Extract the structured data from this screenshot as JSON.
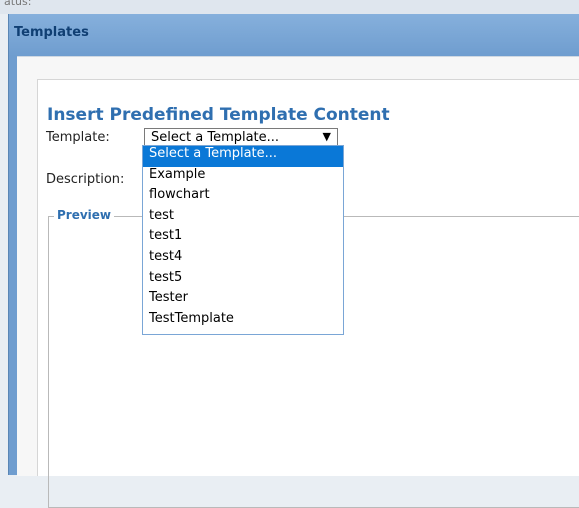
{
  "background": {
    "top_text": "atus:"
  },
  "dialog": {
    "title": "Templates",
    "heading": "Insert Predefined Template Content",
    "template_label": "Template:",
    "description_label": "Description:",
    "select": {
      "selected_value": "Select a Template...",
      "arrow": "▼"
    },
    "preview_legend": "Preview",
    "dropdown": {
      "options": [
        "Select a Template...",
        "Example",
        "flowchart",
        "test",
        "test1",
        "test4",
        "test5",
        "Tester",
        "TestTemplate"
      ],
      "highlighted_index": 0
    }
  },
  "colors": {
    "titlebar": "#6f9dcf",
    "heading": "#2f6fb0",
    "highlight": "#0a78d7"
  }
}
